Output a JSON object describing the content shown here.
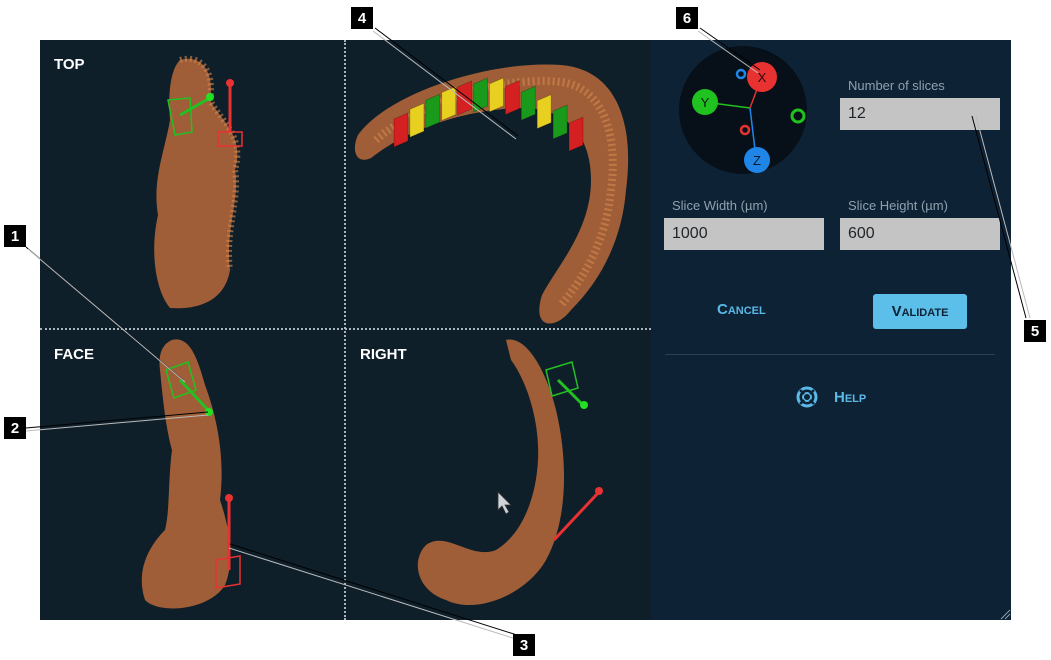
{
  "viewports": {
    "top": {
      "label": "TOP"
    },
    "face": {
      "label": "FACE"
    },
    "right": {
      "label": "RIGHT"
    },
    "perspective": {
      "label": ""
    }
  },
  "gizmo": {
    "axes": [
      {
        "name": "X",
        "color": "#e83232"
      },
      {
        "name": "Y",
        "color": "#1fc21f"
      },
      {
        "name": "Z",
        "color": "#1f86e8"
      }
    ]
  },
  "panel": {
    "number_of_slices": {
      "label": "Number of slices",
      "value": "12"
    },
    "slice_width": {
      "label": "Slice Width (µm)",
      "value": "1000"
    },
    "slice_height": {
      "label": "Slice Height (µm)",
      "value": "600"
    },
    "cancel_label": "Cancel",
    "validate_label": "Validate",
    "help_label": "Help"
  },
  "callouts": [
    "1",
    "2",
    "3",
    "4",
    "5",
    "6"
  ],
  "slice_colors": [
    "#d42020",
    "#e8d020",
    "#1a9a1a",
    "#e8d020",
    "#d42020",
    "#1a9a1a",
    "#e8d020",
    "#d42020",
    "#1a9a1a",
    "#e8d020",
    "#1a9a1a",
    "#d42020"
  ],
  "colors": {
    "background": "#0f202c",
    "panel": "#0e2236",
    "accent": "#5cbfea",
    "specimen": "#b86a3a"
  }
}
